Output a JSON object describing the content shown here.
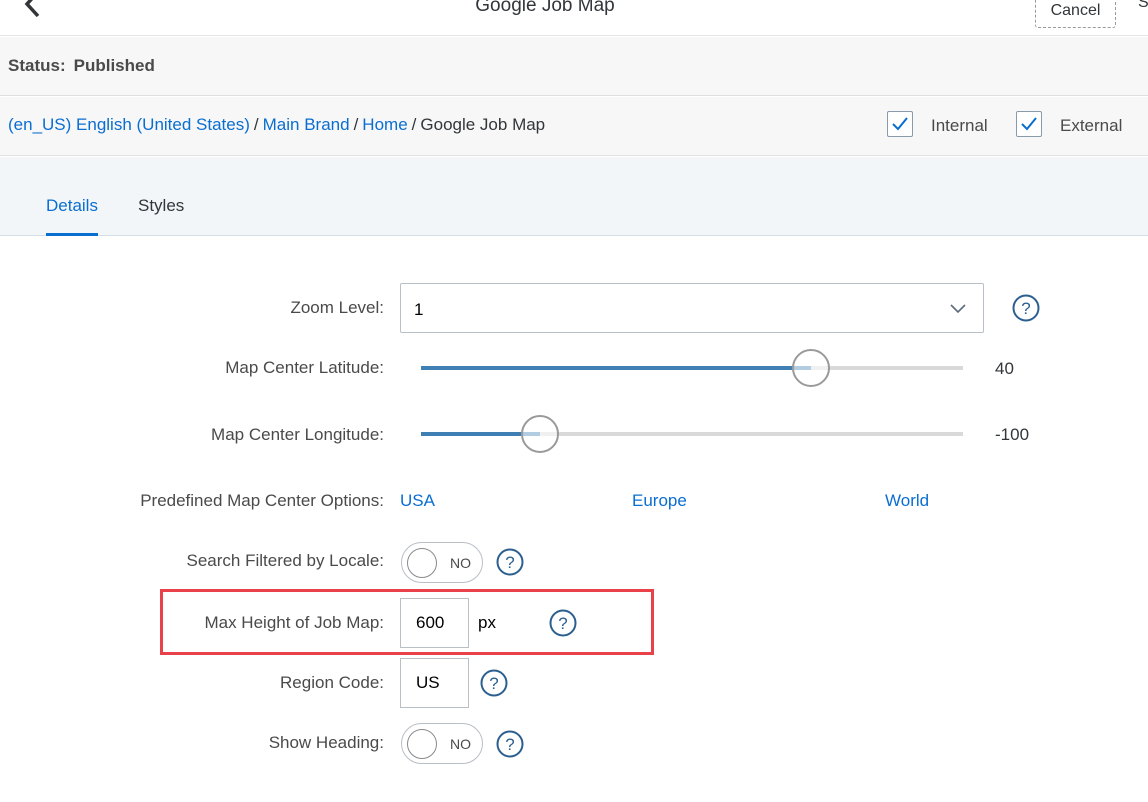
{
  "header": {
    "title": "Google Job Map",
    "cancel_label": "Cancel",
    "save_label_partial": "S"
  },
  "status": {
    "label": "Status:",
    "value": "Published"
  },
  "breadcrumb": {
    "items": [
      "(en_US) English (United States)",
      "Main Brand",
      "Home"
    ],
    "separator": "/",
    "current": "Google Job Map"
  },
  "visibility": {
    "internal_label": "Internal",
    "internal_checked": true,
    "external_label": "External",
    "external_checked": true
  },
  "tabs": [
    {
      "label": "Details",
      "active": true
    },
    {
      "label": "Styles",
      "active": false
    }
  ],
  "form": {
    "zoom_level": {
      "label": "Zoom Level:",
      "value": "1"
    },
    "latitude": {
      "label": "Map Center Latitude:",
      "value": "40",
      "fill_fraction": 0.72
    },
    "longitude": {
      "label": "Map Center Longitude:",
      "value": "-100",
      "fill_fraction": 0.22
    },
    "predefined": {
      "label": "Predefined Map Center Options:",
      "options": [
        "USA",
        "Europe",
        "World"
      ]
    },
    "search_filtered": {
      "label": "Search Filtered by Locale:",
      "value": "NO"
    },
    "max_height": {
      "label": "Max Height of Job Map:",
      "value": "600",
      "unit": "px"
    },
    "region_code": {
      "label": "Region Code:",
      "value": "US"
    },
    "show_heading": {
      "label": "Show Heading:",
      "value": "NO"
    }
  },
  "colors": {
    "accent": "#0a6ed1",
    "slider_fill": "#3f7fb3",
    "highlight": "#e8414a"
  }
}
